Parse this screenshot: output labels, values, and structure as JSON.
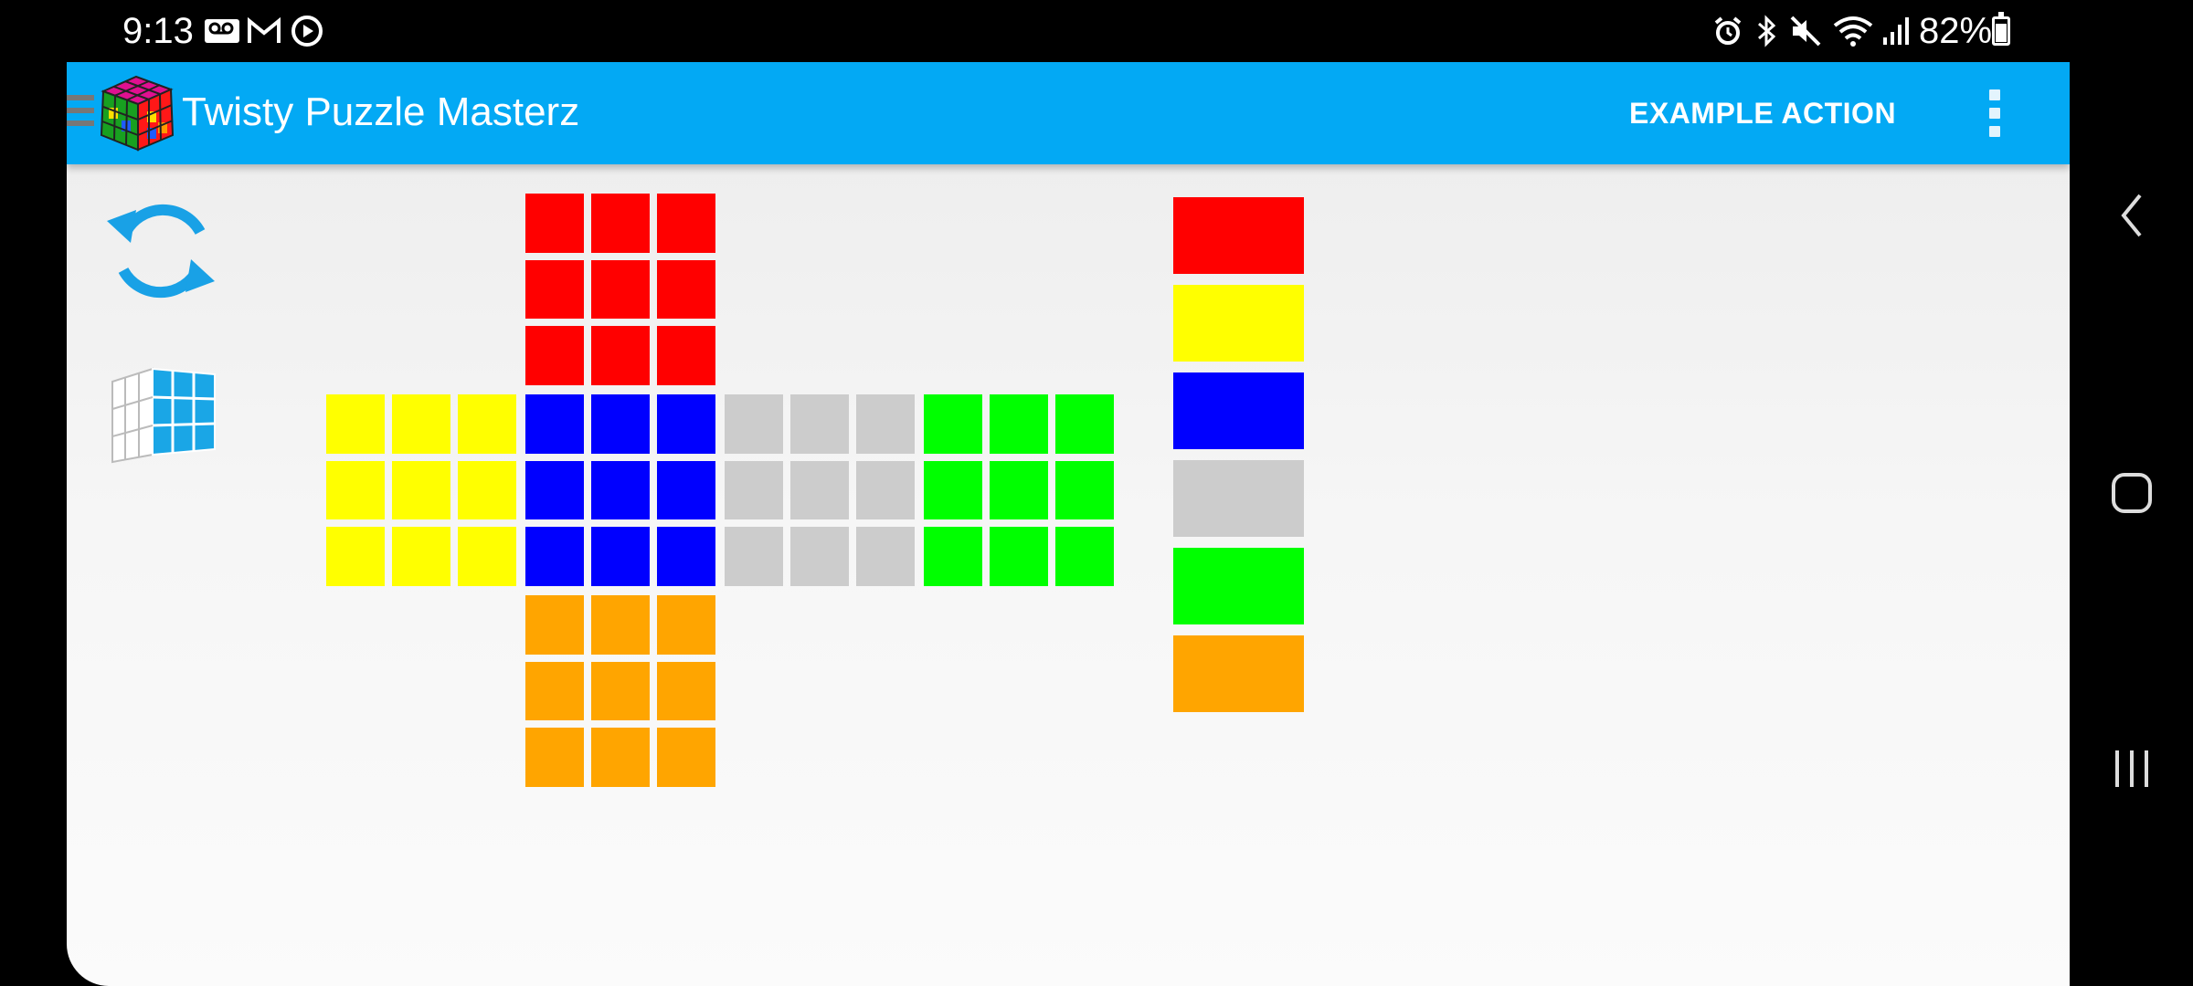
{
  "status_bar": {
    "time": "9:13",
    "battery": "82%",
    "left_icons": [
      "voicemail-icon",
      "gmail-icon",
      "media-play-icon"
    ],
    "right_icons": [
      "alarm-icon",
      "bluetooth-icon",
      "mute-icon",
      "wifi-icon",
      "signal-icon",
      "battery-icon"
    ]
  },
  "app_bar": {
    "title": "Twisty Puzzle Masterz",
    "action_label": "EXAMPLE ACTION",
    "menu_icon": "hamburger-menu-icon",
    "overflow_icon": "more-vert-icon"
  },
  "colors": {
    "red": "#ff0000",
    "yellow": "#ffff00",
    "blue": "#0000ff",
    "gray": "#cccccc",
    "green": "#00ff00",
    "orange": "#ffa500",
    "accent": "#03a9f4"
  },
  "cube_net": [
    {
      "face": "up",
      "stickers": [
        "red",
        "red",
        "red",
        "red",
        "red",
        "red",
        "red",
        "red",
        "red"
      ]
    },
    {
      "face": "left",
      "stickers": [
        "yellow",
        "yellow",
        "yellow",
        "yellow",
        "yellow",
        "yellow",
        "yellow",
        "yellow",
        "yellow"
      ]
    },
    {
      "face": "front",
      "stickers": [
        "blue",
        "blue",
        "blue",
        "blue",
        "blue",
        "blue",
        "blue",
        "blue",
        "blue"
      ]
    },
    {
      "face": "right",
      "stickers": [
        "gray",
        "gray",
        "gray",
        "gray",
        "gray",
        "gray",
        "gray",
        "gray",
        "gray"
      ]
    },
    {
      "face": "back",
      "stickers": [
        "green",
        "green",
        "green",
        "green",
        "green",
        "green",
        "green",
        "green",
        "green"
      ]
    },
    {
      "face": "down",
      "stickers": [
        "orange",
        "orange",
        "orange",
        "orange",
        "orange",
        "orange",
        "orange",
        "orange",
        "orange"
      ]
    }
  ],
  "palette": [
    "red",
    "yellow",
    "blue",
    "gray",
    "green",
    "orange"
  ],
  "side_tools": [
    "reset-icon",
    "cube-3d-view-icon"
  ],
  "nav_bar": [
    "back-icon",
    "home-icon",
    "recents-icon"
  ]
}
